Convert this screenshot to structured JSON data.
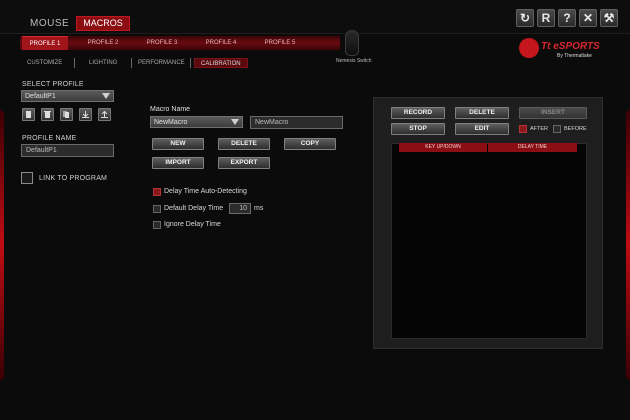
{
  "nav": {
    "mouse": "MOUSE",
    "macros": "MACROS"
  },
  "window_buttons": [
    "refresh-icon",
    "r-icon",
    "help-icon",
    "close-icon",
    "tools-icon"
  ],
  "profiles": [
    "PROFILE 1",
    "PROFILE 2",
    "PROFILE 3",
    "PROFILE 4",
    "PROFILE 5"
  ],
  "subtabs": [
    "CUSTOMIZE",
    "LIGHTING",
    "PERFORMANCE",
    "CALIBRATION"
  ],
  "device": {
    "name": "Nemesis Switch"
  },
  "brand": {
    "logo_text": "Tt eSPORTS",
    "logo_sub": "By Thermaltake",
    "accent": "#c4161c"
  },
  "left": {
    "select_profile_label": "SELECT PROFILE",
    "selected_profile": "DefaultP1",
    "profile_name_label": "PROFILE NAME",
    "profile_name_value": "DefaultP1",
    "link_label": "LINK TO PROGRAM"
  },
  "macro": {
    "name_label": "Macro Name",
    "selected": "NewMacro",
    "name_field": "NewMacro",
    "buttons": {
      "new": "NEW",
      "delete": "DELETE",
      "copy": "COPY",
      "import": "IMPORT",
      "export": "EXPORT"
    },
    "options": {
      "auto_detect": "Delay Time Auto-Detecting",
      "default_delay": "Default Delay Time",
      "delay_value": "10",
      "delay_unit": "ms",
      "ignore_delay": "Ignore Delay Time"
    }
  },
  "recorder": {
    "record": "RECORD",
    "delete": "DELETE",
    "insert": "INSERT",
    "stop": "STOP",
    "edit": "EDIT",
    "after": "AFTER",
    "before": "BEFORE",
    "columns": [
      "KEY UP/DOWN",
      "DELAY TIME"
    ]
  }
}
